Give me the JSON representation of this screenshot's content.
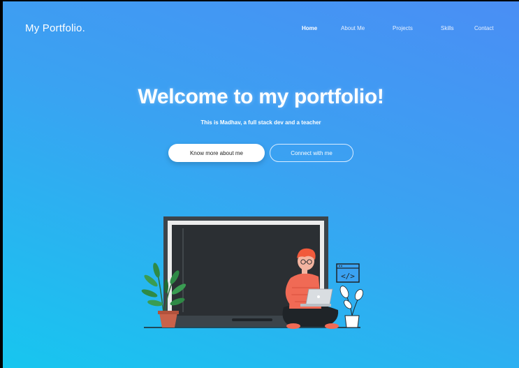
{
  "header": {
    "logo": "My Portfolio.",
    "nav": [
      {
        "label": "Home",
        "active": true
      },
      {
        "label": "About Me",
        "active": false
      },
      {
        "label": "Projects",
        "active": false
      },
      {
        "label": "Skills",
        "active": false
      },
      {
        "label": "Contact",
        "active": false
      }
    ]
  },
  "hero": {
    "title": "Welcome to my portfolio!",
    "subtitle": "This is Madhav, a full stack dev and a teacher",
    "primary_button": "Know more about me",
    "secondary_button": "Connect with me"
  },
  "illustration": {
    "icon": "developer-illustration",
    "code_icon_text": "</>"
  },
  "colors": {
    "gradient_top": "#4a8ef4",
    "gradient_bottom": "#17c6ef",
    "board": "#2b2f33",
    "shirt": "#f06a55",
    "hair": "#f15a3c"
  }
}
